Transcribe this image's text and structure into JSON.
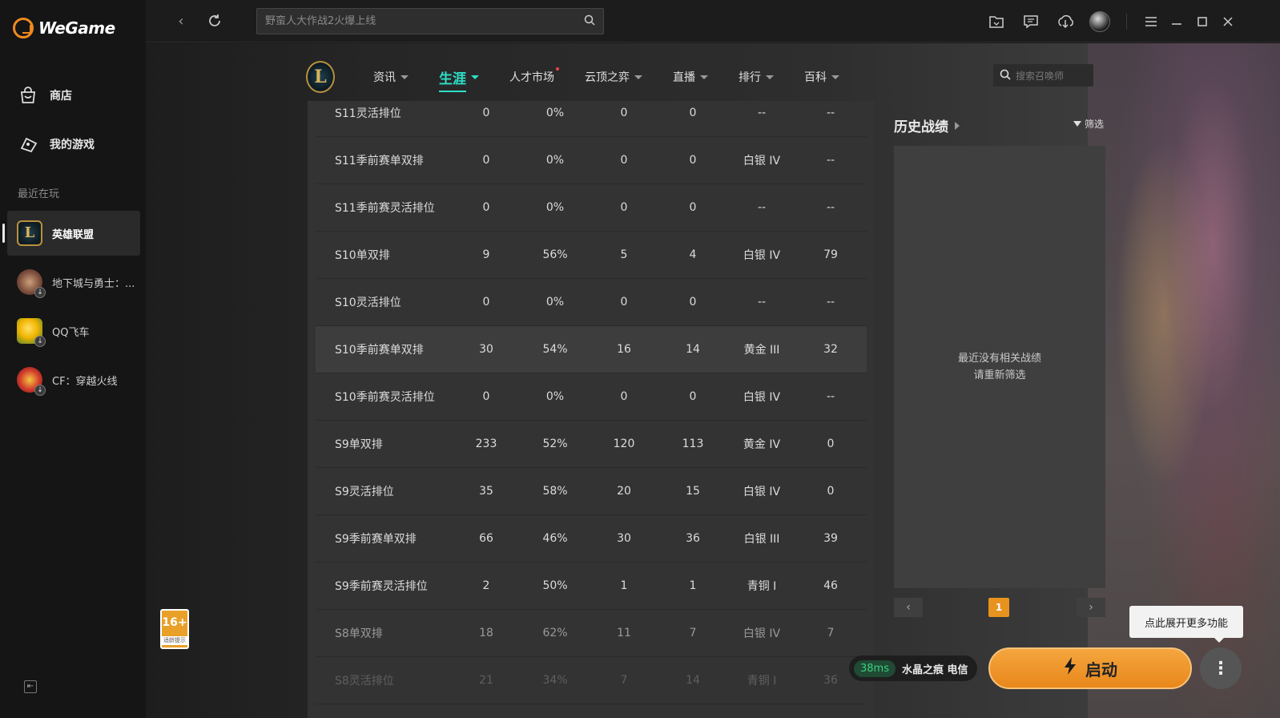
{
  "app": {
    "logo_text": "WeGame"
  },
  "sidebar": {
    "nav": [
      {
        "label": "商店",
        "icon": "shop-bag-icon"
      },
      {
        "label": "我的游戏",
        "icon": "gamepad-icon"
      }
    ],
    "recent_title": "最近在玩",
    "games": [
      {
        "name": "英雄联盟",
        "active": true,
        "download_badge": false
      },
      {
        "name": "地下城与勇士：...",
        "active": false,
        "download_badge": true
      },
      {
        "name": "QQ飞车",
        "active": false,
        "download_badge": true
      },
      {
        "name": "CF：穿越火线",
        "active": false,
        "download_badge": true
      }
    ]
  },
  "topbar": {
    "search_placeholder": "野蛮人大作战2火爆上线",
    "right_icons": [
      "folder-icon",
      "chat-icon",
      "download-icon",
      "user-avatar",
      "menu-icon",
      "minimize-icon",
      "maximize-icon",
      "close-icon"
    ]
  },
  "lol_nav": {
    "logo_letter": "L",
    "tabs": [
      {
        "label": "资讯",
        "active": false,
        "dot": false
      },
      {
        "label": "生涯",
        "active": true,
        "dot": false
      },
      {
        "label": "人才市场",
        "active": false,
        "dot": true
      },
      {
        "label": "云顶之弈",
        "active": false,
        "dot": false
      },
      {
        "label": "直播",
        "active": false,
        "dot": false
      },
      {
        "label": "排行",
        "active": false,
        "dot": false
      },
      {
        "label": "百科",
        "active": false,
        "dot": false
      }
    ],
    "summoner_search_placeholder": "搜索召唤师"
  },
  "ranked_table": {
    "rows": [
      [
        "S11灵活排位",
        "0",
        "0%",
        "0",
        "0",
        "--",
        "--"
      ],
      [
        "S11季前赛单双排",
        "0",
        "0%",
        "0",
        "0",
        "白银 IV",
        "--"
      ],
      [
        "S11季前赛灵活排位",
        "0",
        "0%",
        "0",
        "0",
        "--",
        "--"
      ],
      [
        "S10单双排",
        "9",
        "56%",
        "5",
        "4",
        "白银 IV",
        "79"
      ],
      [
        "S10灵活排位",
        "0",
        "0%",
        "0",
        "0",
        "--",
        "--"
      ],
      [
        "S10季前赛单双排",
        "30",
        "54%",
        "16",
        "14",
        "黄金 III",
        "32"
      ],
      [
        "S10季前赛灵活排位",
        "0",
        "0%",
        "0",
        "0",
        "白银 IV",
        "--"
      ],
      [
        "S9单双排",
        "233",
        "52%",
        "120",
        "113",
        "黄金 IV",
        "0"
      ],
      [
        "S9灵活排位",
        "35",
        "58%",
        "20",
        "15",
        "白银 IV",
        "0"
      ],
      [
        "S9季前赛单双排",
        "66",
        "46%",
        "30",
        "36",
        "白银 III",
        "39"
      ],
      [
        "S9季前赛灵活排位",
        "2",
        "50%",
        "1",
        "1",
        "青铜 I",
        "46"
      ],
      [
        "S8单双排",
        "18",
        "62%",
        "11",
        "7",
        "白银 IV",
        "7"
      ],
      [
        "S8灵活排位",
        "21",
        "34%",
        "7",
        "14",
        "青铜 I",
        "36"
      ]
    ],
    "highlighted_row": 5
  },
  "history": {
    "title": "历史战绩",
    "filter_label": "筛选",
    "empty_line1": "最近没有相关战绩",
    "empty_line2": "请重新筛选",
    "current_page": "1",
    "prev": "‹",
    "next": "›"
  },
  "age_badge": {
    "age": "16+",
    "caption": "适龄提示"
  },
  "launch": {
    "ping": "38ms",
    "server": "水晶之痕 电信",
    "button_label": "启动",
    "tooltip": "点此展开更多功能",
    "more_symbol": "⋮"
  }
}
